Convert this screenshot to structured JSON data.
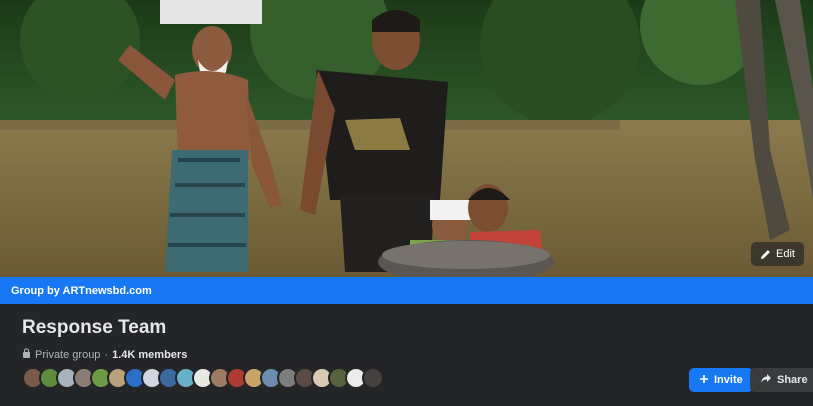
{
  "cover": {
    "edit_label": "Edit"
  },
  "group": {
    "banner": "Group by ARTnewsbd.com",
    "name": "Response Team",
    "privacy": "Private group",
    "separator": "·",
    "members": "1.4K members"
  },
  "avatars": [
    {
      "name": "member-1",
      "color": "#7a5a4a"
    },
    {
      "name": "member-2",
      "color": "#5d8c3e"
    },
    {
      "name": "member-3",
      "color": "#a9b3bc"
    },
    {
      "name": "member-4",
      "color": "#8a7e74"
    },
    {
      "name": "member-5",
      "color": "#6c9a45"
    },
    {
      "name": "member-6",
      "color": "#b8a27c"
    },
    {
      "name": "member-7",
      "color": "#2c6fc9"
    },
    {
      "name": "member-8",
      "color": "#cfd6df"
    },
    {
      "name": "member-9",
      "color": "#3b6aa0"
    },
    {
      "name": "member-10",
      "color": "#69b0c9"
    },
    {
      "name": "member-11",
      "color": "#e9e9e3"
    },
    {
      "name": "member-12",
      "color": "#9c7b63"
    },
    {
      "name": "member-13",
      "color": "#b03b34"
    },
    {
      "name": "member-14",
      "color": "#c9a46a"
    },
    {
      "name": "member-15",
      "color": "#6c8bb0"
    },
    {
      "name": "member-16",
      "color": "#7d7d7d"
    },
    {
      "name": "member-17",
      "color": "#5a4a43"
    },
    {
      "name": "member-18",
      "color": "#d7c9b4"
    },
    {
      "name": "member-19",
      "color": "#57633f"
    },
    {
      "name": "member-20",
      "color": "#ececec"
    },
    {
      "name": "member-21",
      "color": "#46413f"
    }
  ],
  "actions": {
    "invite_label": "Invite",
    "share_label": "Share"
  },
  "colors": {
    "accent": "#1877f2",
    "background": "#242526",
    "text_primary": "#e4e6eb",
    "text_secondary": "#b0b3b8"
  },
  "icons": {
    "edit": "pencil-icon",
    "privacy": "lock-icon",
    "invite": "plus-icon",
    "share": "share-arrow-icon"
  }
}
